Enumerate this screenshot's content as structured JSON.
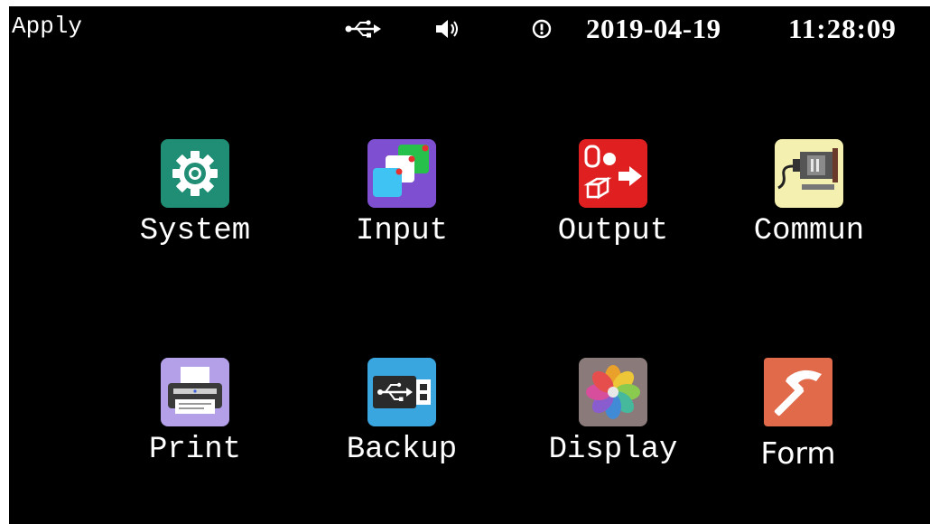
{
  "status_bar": {
    "title": "Apply",
    "icons": [
      "usb-icon",
      "speaker-icon",
      "alert-icon"
    ],
    "date": "2019-04-19",
    "time": "11:28:09"
  },
  "apps": [
    {
      "label": "System",
      "icon": "gear-icon",
      "color": "#1f8e74"
    },
    {
      "label": "Input",
      "icon": "input-squares-icon",
      "color": "#7e4fd0"
    },
    {
      "label": "Output",
      "icon": "output-shapes-icon",
      "color": "#e02020"
    },
    {
      "label": "Commun",
      "icon": "serial-connector-icon",
      "color": "#f4f0b0"
    },
    {
      "label": "Print",
      "icon": "printer-icon",
      "color": "#b4a0e8"
    },
    {
      "label": "Backup",
      "icon": "usb-drive-icon",
      "color": "#3aa6e0"
    },
    {
      "label": "Display",
      "icon": "photos-flower-icon",
      "color": "#8a7a7a"
    },
    {
      "label": "Form",
      "icon": "hammer-icon",
      "color": "#e06a4a"
    }
  ],
  "colors": {
    "screen_background": "#000000",
    "text": "#ffffff"
  }
}
